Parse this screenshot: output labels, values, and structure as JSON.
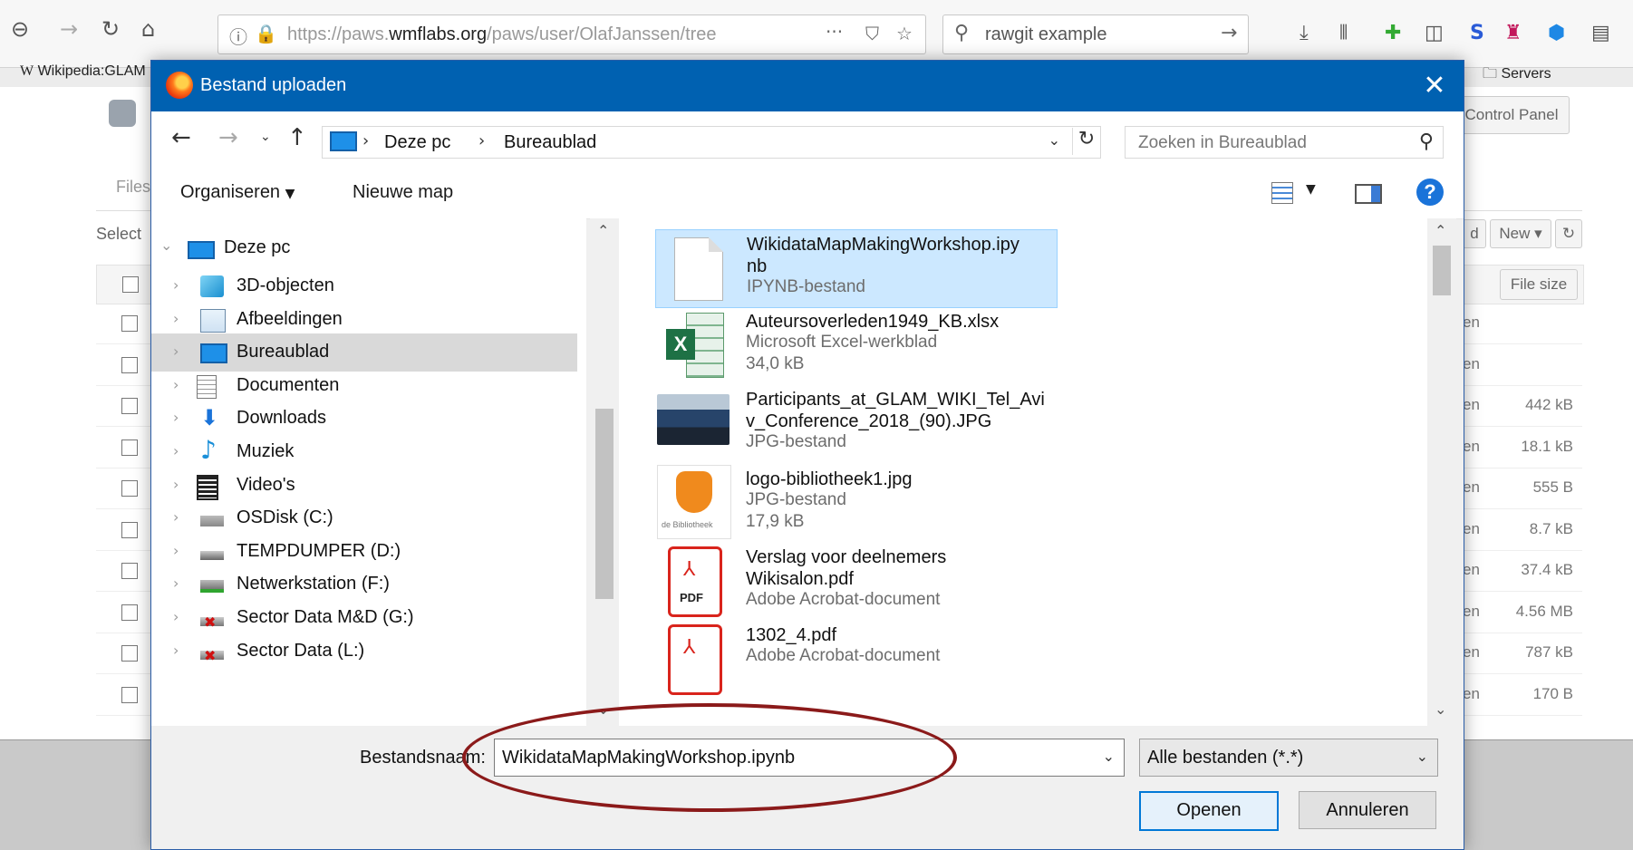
{
  "browser": {
    "url_prefix": "https://paws.",
    "url_host": "wmflabs.org",
    "url_path": "/paws/user/OlafJanssen/tree",
    "url_more": "···",
    "search_value": "rawgit example",
    "bookmark_left": "Wikipedia:GLAM",
    "bookmark_right": "Servers",
    "paws": {
      "files_tab": "Files",
      "select_text": "Select",
      "control_panel": "Control Panel",
      "upload_partial": "d",
      "new_label": "New",
      "file_size_header": "File size",
      "open_partial": "en",
      "sizes": [
        "",
        "",
        "442 kB",
        "18.1 kB",
        "555 B",
        "8.7 kB",
        "37.4 kB",
        "4.56 MB",
        "787 kB",
        "170 B"
      ]
    }
  },
  "dialog": {
    "title": "Bestand uploaden",
    "breadcrumb": [
      "Deze pc",
      "Bureaublad"
    ],
    "search_placeholder": "Zoeken in Bureaublad",
    "toolbar": {
      "organize": "Organiseren",
      "new_folder": "Nieuwe map"
    },
    "nav": {
      "root": "Deze pc",
      "items": [
        {
          "label": "3D-objecten",
          "icon": "cube-icon"
        },
        {
          "label": "Afbeeldingen",
          "icon": "pictures-icon"
        },
        {
          "label": "Bureaublad",
          "icon": "desktop-icon",
          "selected": true
        },
        {
          "label": "Documenten",
          "icon": "documents-icon"
        },
        {
          "label": "Downloads",
          "icon": "download-arrow-icon"
        },
        {
          "label": "Muziek",
          "icon": "music-note-icon"
        },
        {
          "label": "Video's",
          "icon": "film-icon"
        },
        {
          "label": "OSDisk (C:)",
          "icon": "windows-drive-icon"
        },
        {
          "label": "TEMPDUMPER (D:)",
          "icon": "drive-icon"
        },
        {
          "label": "Netwerkstation (F:)",
          "icon": "network-drive-icon"
        },
        {
          "label": "Sector Data M&D (G:)",
          "icon": "disconnected-drive-icon"
        },
        {
          "label": "Sector Data (L:)",
          "icon": "disconnected-drive-icon"
        }
      ]
    },
    "files": [
      {
        "name_lines": [
          "WikidataMapMakingWorkshop.ipy",
          "nb"
        ],
        "type": "IPYNB-bestand",
        "size": "",
        "thumb": "blank-file-icon",
        "selected": true
      },
      {
        "name_lines": [
          "Auteursoverleden1949_KB.xlsx"
        ],
        "type": "Microsoft Excel-werkblad",
        "size": "34,0 kB",
        "thumb": "excel-icon"
      },
      {
        "name_lines": [
          "Participants_at_GLAM_WIKI_Tel_Avi",
          "v_Conference_2018_(90).JPG"
        ],
        "type": "JPG-bestand",
        "size": "",
        "thumb": "photo-thumbnail"
      },
      {
        "name_lines": [
          "logo-bibliotheek1.jpg"
        ],
        "type": "JPG-bestand",
        "size": "17,9 kB",
        "thumb": "bibliotheek-logo",
        "logo_caption": "de Bibliotheek"
      },
      {
        "name_lines": [
          "Verslag voor deelnemers",
          "Wikisalon.pdf"
        ],
        "type": "Adobe Acrobat-document",
        "size": "",
        "thumb": "pdf-icon",
        "pdf_label": "PDF"
      },
      {
        "name_lines": [
          "1302_4.pdf"
        ],
        "type": "Adobe Acrobat-document",
        "size": "",
        "thumb": "pdf-icon"
      }
    ],
    "filename_label": "Bestandsnaam:",
    "filename_value": "WikidataMapMakingWorkshop.ipynb",
    "filetype_value": "Alle bestanden (*.*)",
    "open_button": "Openen",
    "cancel_button": "Annuleren"
  },
  "colors": {
    "titlebar": "#0061b1",
    "selection": "#cce8ff",
    "annotation": "#8b1a1a",
    "pdf_red": "#d9241c",
    "excel_green": "#1e7145"
  }
}
